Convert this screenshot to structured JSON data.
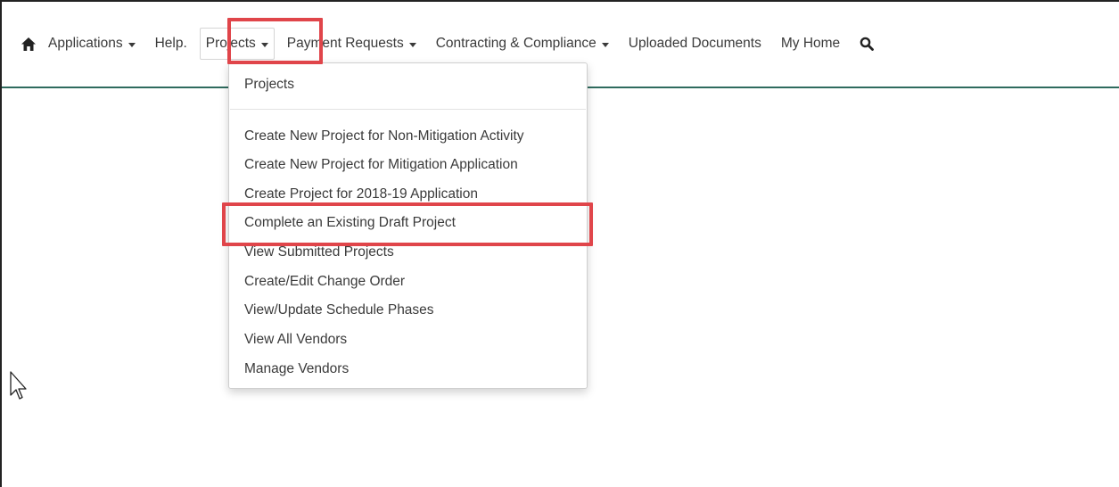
{
  "nav": {
    "home_icon": "home-icon",
    "applications": "Applications",
    "help": "Help.",
    "projects": "Projects",
    "payment_requests": "Payment Requests",
    "contracting": "Contracting & Compliance",
    "uploaded_documents": "Uploaded Documents",
    "my_home": "My Home",
    "search_icon": "search-icon"
  },
  "projects_menu": {
    "header_item": "Projects",
    "items": [
      "Create New Project for Non-Mitigation Activity",
      "Create New Project for Mitigation Application",
      "Create Project for 2018-19 Application",
      "Complete an Existing Draft Project",
      "View Submitted Projects",
      "Create/Edit Change Order",
      "View/Update Schedule Phases",
      "View All Vendors",
      "Manage Vendors"
    ]
  },
  "colors": {
    "highlight": "#e0454a",
    "nav_border": "#2f6b5e",
    "text": "#3a3a3a"
  }
}
